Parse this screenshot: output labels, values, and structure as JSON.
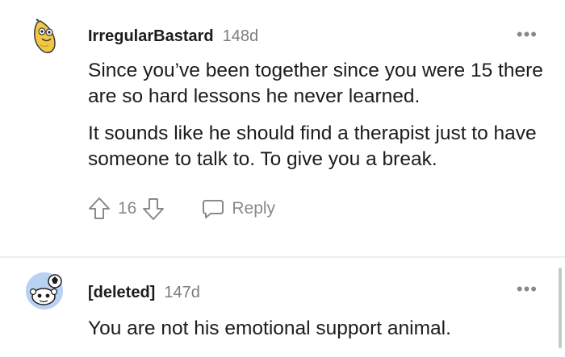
{
  "comments": [
    {
      "author": "IrregularBastard",
      "age": "148d",
      "paragraphs": [
        "Since you’ve been together since you were 15 there are so hard lessons he never learned.",
        "It sounds like he should find a therapist just to have someone to talk to. To give you a break."
      ],
      "votes": "16",
      "reply_label": "Reply",
      "more_label": "•••"
    },
    {
      "author": "[deleted]",
      "age": "147d",
      "paragraphs": [
        "You are not his emotional support animal."
      ],
      "more_label": "•••"
    }
  ],
  "colors": {
    "text": "#1c1c1c",
    "meta": "#7c7c7c",
    "icon": "#878a8c",
    "divider": "#edeff1",
    "avatar2_bg": "#b9d1f3"
  }
}
